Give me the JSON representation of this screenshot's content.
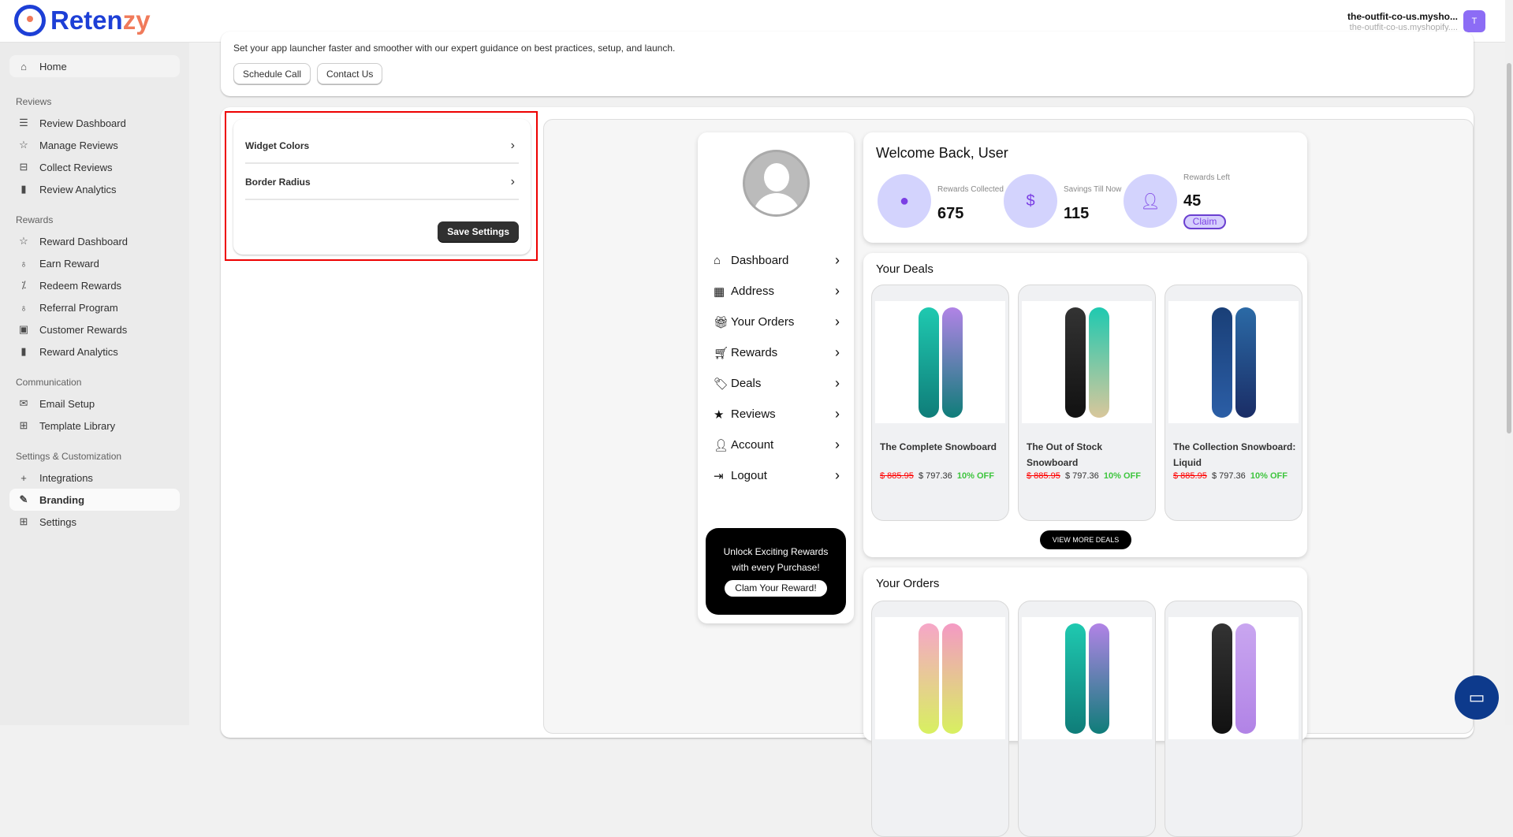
{
  "header": {
    "brand_prefix": "Reten",
    "brand_suffix": "zy",
    "store_name": "the-outfit-co-us.mysho...",
    "store_domain": "the-outfit-co-us.myshopify....",
    "avatar_initial": "T"
  },
  "sidebar": {
    "home": "Home",
    "sections": [
      {
        "title": "Reviews",
        "items": [
          {
            "label": "Review Dashboard",
            "icon": "inbox-stack-icon"
          },
          {
            "label": "Manage Reviews",
            "icon": "star-icon"
          },
          {
            "label": "Collect Reviews",
            "icon": "inbox-icon"
          },
          {
            "label": "Review Analytics",
            "icon": "bar-chart-icon"
          }
        ]
      },
      {
        "title": "Rewards",
        "items": [
          {
            "label": "Reward Dashboard",
            "icon": "star-icon"
          },
          {
            "label": "Earn Reward",
            "icon": "award-icon"
          },
          {
            "label": "Redeem Rewards",
            "icon": "discount-icon"
          },
          {
            "label": "Referral Program",
            "icon": "award-icon"
          },
          {
            "label": "Customer Rewards",
            "icon": "gift-card-icon"
          },
          {
            "label": "Reward Analytics",
            "icon": "bar-chart-icon"
          }
        ]
      },
      {
        "title": "Communication",
        "items": [
          {
            "label": "Email Setup",
            "icon": "email-icon"
          },
          {
            "label": "Template Library",
            "icon": "apps-icon"
          }
        ]
      },
      {
        "title": "Settings & Customization",
        "items": [
          {
            "label": "Integrations",
            "icon": "plus-icon"
          },
          {
            "label": "Branding",
            "icon": "paintbrush-icon"
          },
          {
            "label": "Settings",
            "icon": "apps-icon"
          }
        ]
      }
    ]
  },
  "banner": {
    "text": "Set your app launcher faster and smoother with our expert guidance on best practices, setup, and launch.",
    "schedule": "Schedule Call",
    "contact": "Contact Us"
  },
  "settings": {
    "widget_colors": "Widget Colors",
    "border_radius": "Border Radius",
    "save": "Save Settings"
  },
  "preview": {
    "menu": [
      "Dashboard",
      "Address",
      "Your Orders",
      "Rewards",
      "Deals",
      "Reviews",
      "Account",
      "Logout"
    ],
    "promo_text": "Unlock Exciting Rewards with every Purchase!",
    "promo_button": "Clam Your Reward!",
    "welcome": "Welcome Back, User",
    "stats": [
      {
        "label": "Rewards Collected",
        "value": "675"
      },
      {
        "label": "Savings Till Now",
        "value": "115"
      },
      {
        "label": "Rewards Left",
        "value": "45"
      }
    ],
    "claim": "Claim",
    "deals_title": "Your Deals",
    "deals": [
      {
        "name": "The Complete Snowboard",
        "old": "$ 885.95",
        "price": "$ 797.36",
        "off": "10% OFF"
      },
      {
        "name": "The Out of Stock Snowboard",
        "old": "$ 885.95",
        "price": "$ 797.36",
        "off": "10% OFF"
      },
      {
        "name": "The Collection Snowboard: Liquid",
        "old": "$ 885.95",
        "price": "$ 797.36",
        "off": "10% OFF"
      }
    ],
    "view_more": "VIEW MORE DEALS",
    "orders_title": "Your Orders"
  }
}
